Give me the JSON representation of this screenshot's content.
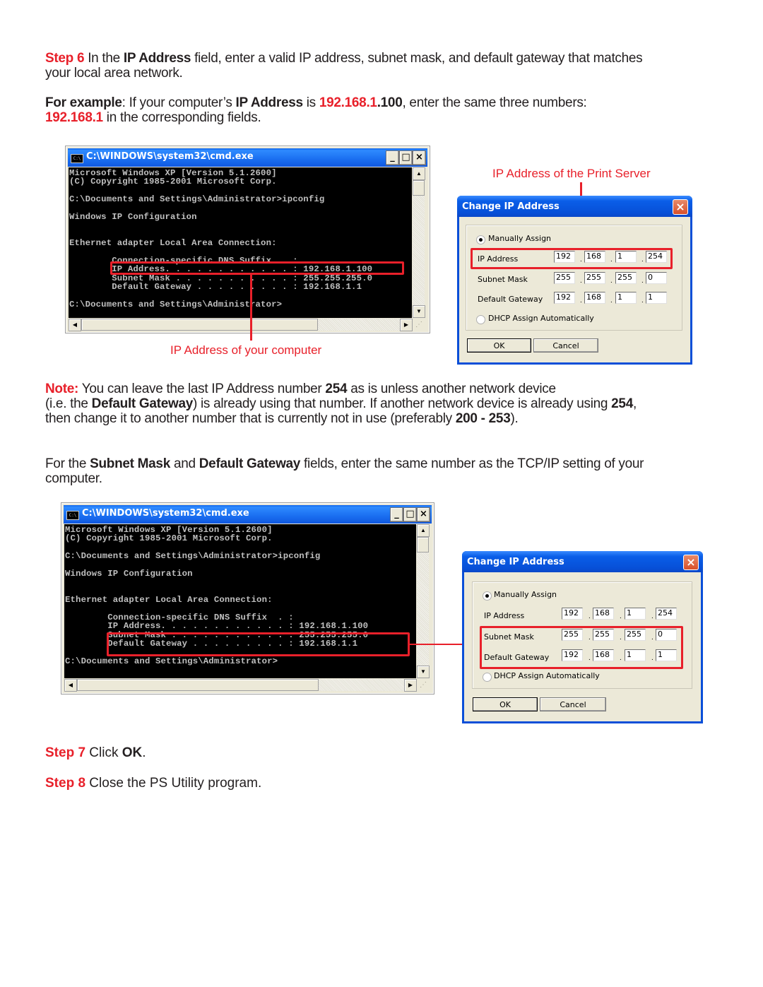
{
  "step6": {
    "label": "Step 6",
    "t1": " In the ",
    "b1": "IP Address",
    "t2": " field, enter a valid IP address, subnet mask, and default gateway that matches",
    "t3": "your local area network."
  },
  "example": {
    "label": "For example",
    "t1": ": If your computer’s ",
    "b1": "IP Address",
    "t2": " is ",
    "ip_red": "192.168.1",
    "ip_black": ".100",
    "t3": ", enter the same three numbers:",
    "prefix": "192.168.1",
    "t4": " in the corresponding fields."
  },
  "cmd_window": {
    "title": "C:\\WINDOWS\\system32\\cmd.exe",
    "icon": "cmd-console-icon",
    "icon_text": "C:\\",
    "minimize": "_",
    "maximize": "□",
    "close": "×",
    "scroll_up": "▲",
    "scroll_down": "▼",
    "scroll_left": "◀",
    "scroll_right": "▶",
    "grip": "⋰",
    "lines": [
      "Microsoft Windows XP [Version 5.1.2600]",
      "(C) Copyright 1985-2001 Microsoft Corp.",
      "",
      "C:\\Documents and Settings\\Administrator>ipconfig",
      "",
      "Windows IP Configuration",
      "",
      "",
      "Ethernet adapter Local Area Connection:",
      "",
      "        Connection-specific DNS Suffix  . :",
      "        IP Address. . . . . . . . . . . . : 192.168.1.100",
      "        Subnet Mask . . . . . . . . . . . : 255.255.255.0",
      "        Default Gateway . . . . . . . . . : 192.168.1.1",
      "",
      "C:\\Documents and Settings\\Administrator>"
    ]
  },
  "callouts": {
    "print_server": "IP Address of the Print Server",
    "your_computer": "IP Address of your computer"
  },
  "dialog": {
    "title": "Change IP Address",
    "close": "×",
    "manual_label": "Manually Assign",
    "manual_selected": true,
    "dhcp_label": "DHCP Assign Automatically",
    "dhcp_selected": false,
    "ip_label": "IP Address",
    "ip": [
      "192",
      "168",
      "1",
      "254"
    ],
    "mask_label": "Subnet Mask",
    "mask": [
      "255",
      "255",
      "255",
      "0"
    ],
    "gw_label": "Default Gateway",
    "gw": [
      "192",
      "168",
      "1",
      "1"
    ],
    "ok": "OK",
    "cancel": "Cancel"
  },
  "note": {
    "label": "Note:",
    "t1": " You can leave the last IP Address number ",
    "n1": "254",
    "t2": " as is unless another network device",
    "t3": "(i.e. the ",
    "b1": "Default Gateway",
    "t4": ") is already using that number. If another network device is already using ",
    "n2": "254",
    "t5": ",",
    "t6": "then change it to another number that is currently not in use (preferably ",
    "range": "200 - 253",
    "t7": ")."
  },
  "subnet_para": {
    "t1": "For the ",
    "b1": "Subnet Mask",
    "t2": " and ",
    "b2": "Default Gateway",
    "t3": " fields, enter the same number as the TCP/IP setting of your",
    "t4": "computer."
  },
  "step7": {
    "label": "Step 7",
    "t1": " Click ",
    "b1": "OK",
    "t2": "."
  },
  "step8": {
    "label": "Step 8",
    "t1": " Close the PS Utility program."
  },
  "colors": {
    "accent_red": "#e8202a",
    "body_text": "#231f20",
    "xp_title_blue": "#0a5ee8",
    "xp_face": "#ece9d8"
  }
}
